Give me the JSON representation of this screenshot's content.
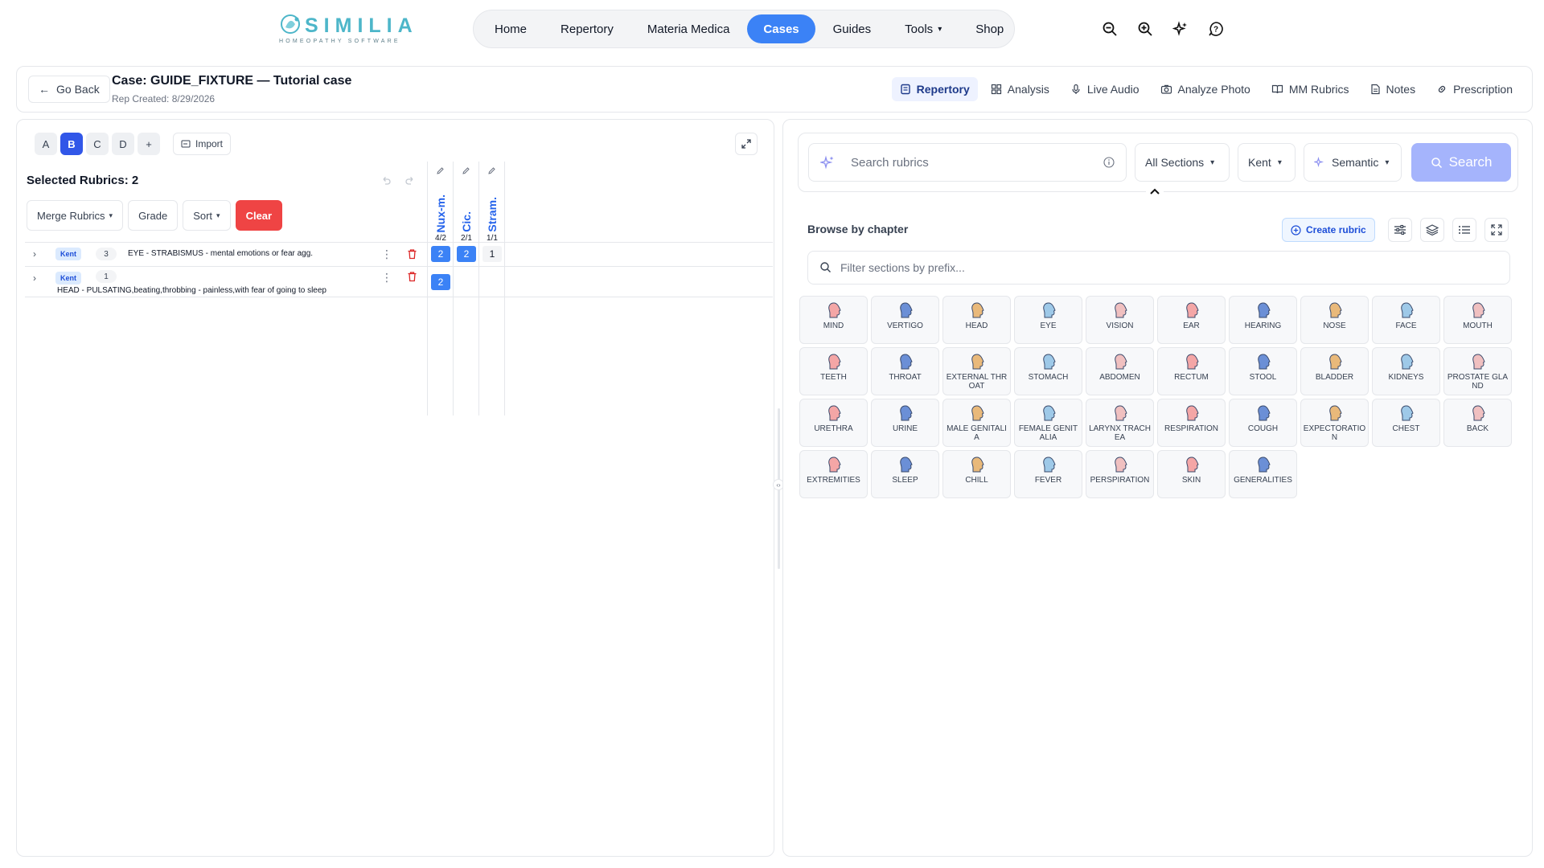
{
  "brand": {
    "name": "SIMILIA",
    "tagline": "HOMEOPATHY SOFTWARE",
    "color": "#4db6c9"
  },
  "nav": {
    "items": [
      {
        "label": "Home",
        "active": false
      },
      {
        "label": "Repertory",
        "active": false
      },
      {
        "label": "Materia Medica",
        "active": false
      },
      {
        "label": "Cases",
        "active": true
      },
      {
        "label": "Guides",
        "active": false
      },
      {
        "label": "Tools",
        "active": false,
        "dropdown": true
      },
      {
        "label": "Shop",
        "active": false
      }
    ],
    "accent": "#3b82f6",
    "icons": [
      "zoom-out-icon",
      "zoom-in-icon",
      "sparkle-icon",
      "help-icon"
    ]
  },
  "case": {
    "back_label": "Go Back",
    "title": "Case: GUIDE_FIXTURE — Tutorial case",
    "subtitle": "Rep Created: 8/29/2026",
    "tabs": [
      {
        "label": "Repertory",
        "icon": "book-icon",
        "active": true
      },
      {
        "label": "Analysis",
        "icon": "grid-icon",
        "active": false
      },
      {
        "label": "Live Audio",
        "icon": "mic-icon",
        "active": false
      },
      {
        "label": "Analyze Photo",
        "icon": "camera-icon",
        "active": false
      },
      {
        "label": "MM Rubrics",
        "icon": "open-book-icon",
        "active": false
      },
      {
        "label": "Notes",
        "icon": "note-icon",
        "active": false
      },
      {
        "label": "Prescription",
        "icon": "link-icon",
        "active": false
      }
    ]
  },
  "left": {
    "letters": [
      {
        "label": "A",
        "active": false
      },
      {
        "label": "B",
        "active": true
      },
      {
        "label": "C",
        "active": false
      },
      {
        "label": "D",
        "active": false
      },
      {
        "label": "+",
        "active": false
      }
    ],
    "import_label": "Import",
    "selected_title": "Selected Rubrics: 2",
    "toolbar": {
      "merge_label": "Merge Rubrics",
      "grade_label": "Grade",
      "sort_label": "Sort",
      "clear_label": "Clear"
    },
    "remedies": [
      {
        "abbr": "Nux-m.",
        "ratio": "4/2"
      },
      {
        "abbr": "Cic.",
        "ratio": "2/1"
      },
      {
        "abbr": "Stram.",
        "ratio": "1/1"
      }
    ],
    "rubrics": [
      {
        "repertory": "Kent",
        "count": "3",
        "text": "EYE - STRABISMUS - mental emotions or fear agg.",
        "grades": [
          "2",
          "2",
          "1"
        ]
      },
      {
        "repertory": "Kent",
        "count": "1",
        "text": "HEAD - PULSATING,beating,throbbing - painless,with fear of going to sleep",
        "grades": [
          "2",
          "",
          ""
        ]
      }
    ]
  },
  "right": {
    "search_placeholder": "Search rubrics",
    "sections_label": "All Sections",
    "repertory_label": "Kent",
    "mode_label": "Semantic",
    "search_button": "Search",
    "browse_title": "Browse by chapter",
    "create_rubric_label": "Create rubric",
    "filter_placeholder": "Filter sections by prefix...",
    "chapters": [
      {
        "label": "MIND",
        "icon": "mind-icon"
      },
      {
        "label": "VERTIGO",
        "icon": "vertigo-icon"
      },
      {
        "label": "HEAD",
        "icon": "head-icon"
      },
      {
        "label": "EYE",
        "icon": "eye-icon"
      },
      {
        "label": "VISION",
        "icon": "vision-icon"
      },
      {
        "label": "EAR",
        "icon": "ear-icon"
      },
      {
        "label": "HEARING",
        "icon": "hearing-icon"
      },
      {
        "label": "NOSE",
        "icon": "nose-icon"
      },
      {
        "label": "FACE",
        "icon": "face-icon"
      },
      {
        "label": "MOUTH",
        "icon": "mouth-icon"
      },
      {
        "label": "TEETH",
        "icon": "teeth-icon"
      },
      {
        "label": "THROAT",
        "icon": "throat-icon"
      },
      {
        "label": "EXTERNAL THROAT",
        "icon": "external-throat-icon"
      },
      {
        "label": "STOMACH",
        "icon": "stomach-icon"
      },
      {
        "label": "ABDOMEN",
        "icon": "abdomen-icon"
      },
      {
        "label": "RECTUM",
        "icon": "rectum-icon"
      },
      {
        "label": "STOOL",
        "icon": "stool-icon"
      },
      {
        "label": "BLADDER",
        "icon": "bladder-icon"
      },
      {
        "label": "KIDNEYS",
        "icon": "kidneys-icon"
      },
      {
        "label": "PROSTATE GLAND",
        "icon": "prostate-icon"
      },
      {
        "label": "URETHRA",
        "icon": "urethra-icon"
      },
      {
        "label": "URINE",
        "icon": "urine-icon"
      },
      {
        "label": "MALE GENITALIA",
        "icon": "male-icon"
      },
      {
        "label": "FEMALE GENITALIA",
        "icon": "female-icon"
      },
      {
        "label": "LARYNX TRACHEA",
        "icon": "larynx-icon"
      },
      {
        "label": "RESPIRATION",
        "icon": "respiration-icon"
      },
      {
        "label": "COUGH",
        "icon": "cough-icon"
      },
      {
        "label": "EXPECTORATION",
        "icon": "expectoration-icon"
      },
      {
        "label": "CHEST",
        "icon": "chest-icon"
      },
      {
        "label": "BACK",
        "icon": "back-icon"
      },
      {
        "label": "EXTREMITIES",
        "icon": "extremities-icon"
      },
      {
        "label": "SLEEP",
        "icon": "sleep-icon"
      },
      {
        "label": "CHILL",
        "icon": "chill-icon"
      },
      {
        "label": "FEVER",
        "icon": "fever-icon"
      },
      {
        "label": "PERSPIRATION",
        "icon": "perspiration-icon"
      },
      {
        "label": "SKIN",
        "icon": "skin-icon"
      },
      {
        "label": "GENERALITIES",
        "icon": "generalities-icon"
      }
    ]
  }
}
